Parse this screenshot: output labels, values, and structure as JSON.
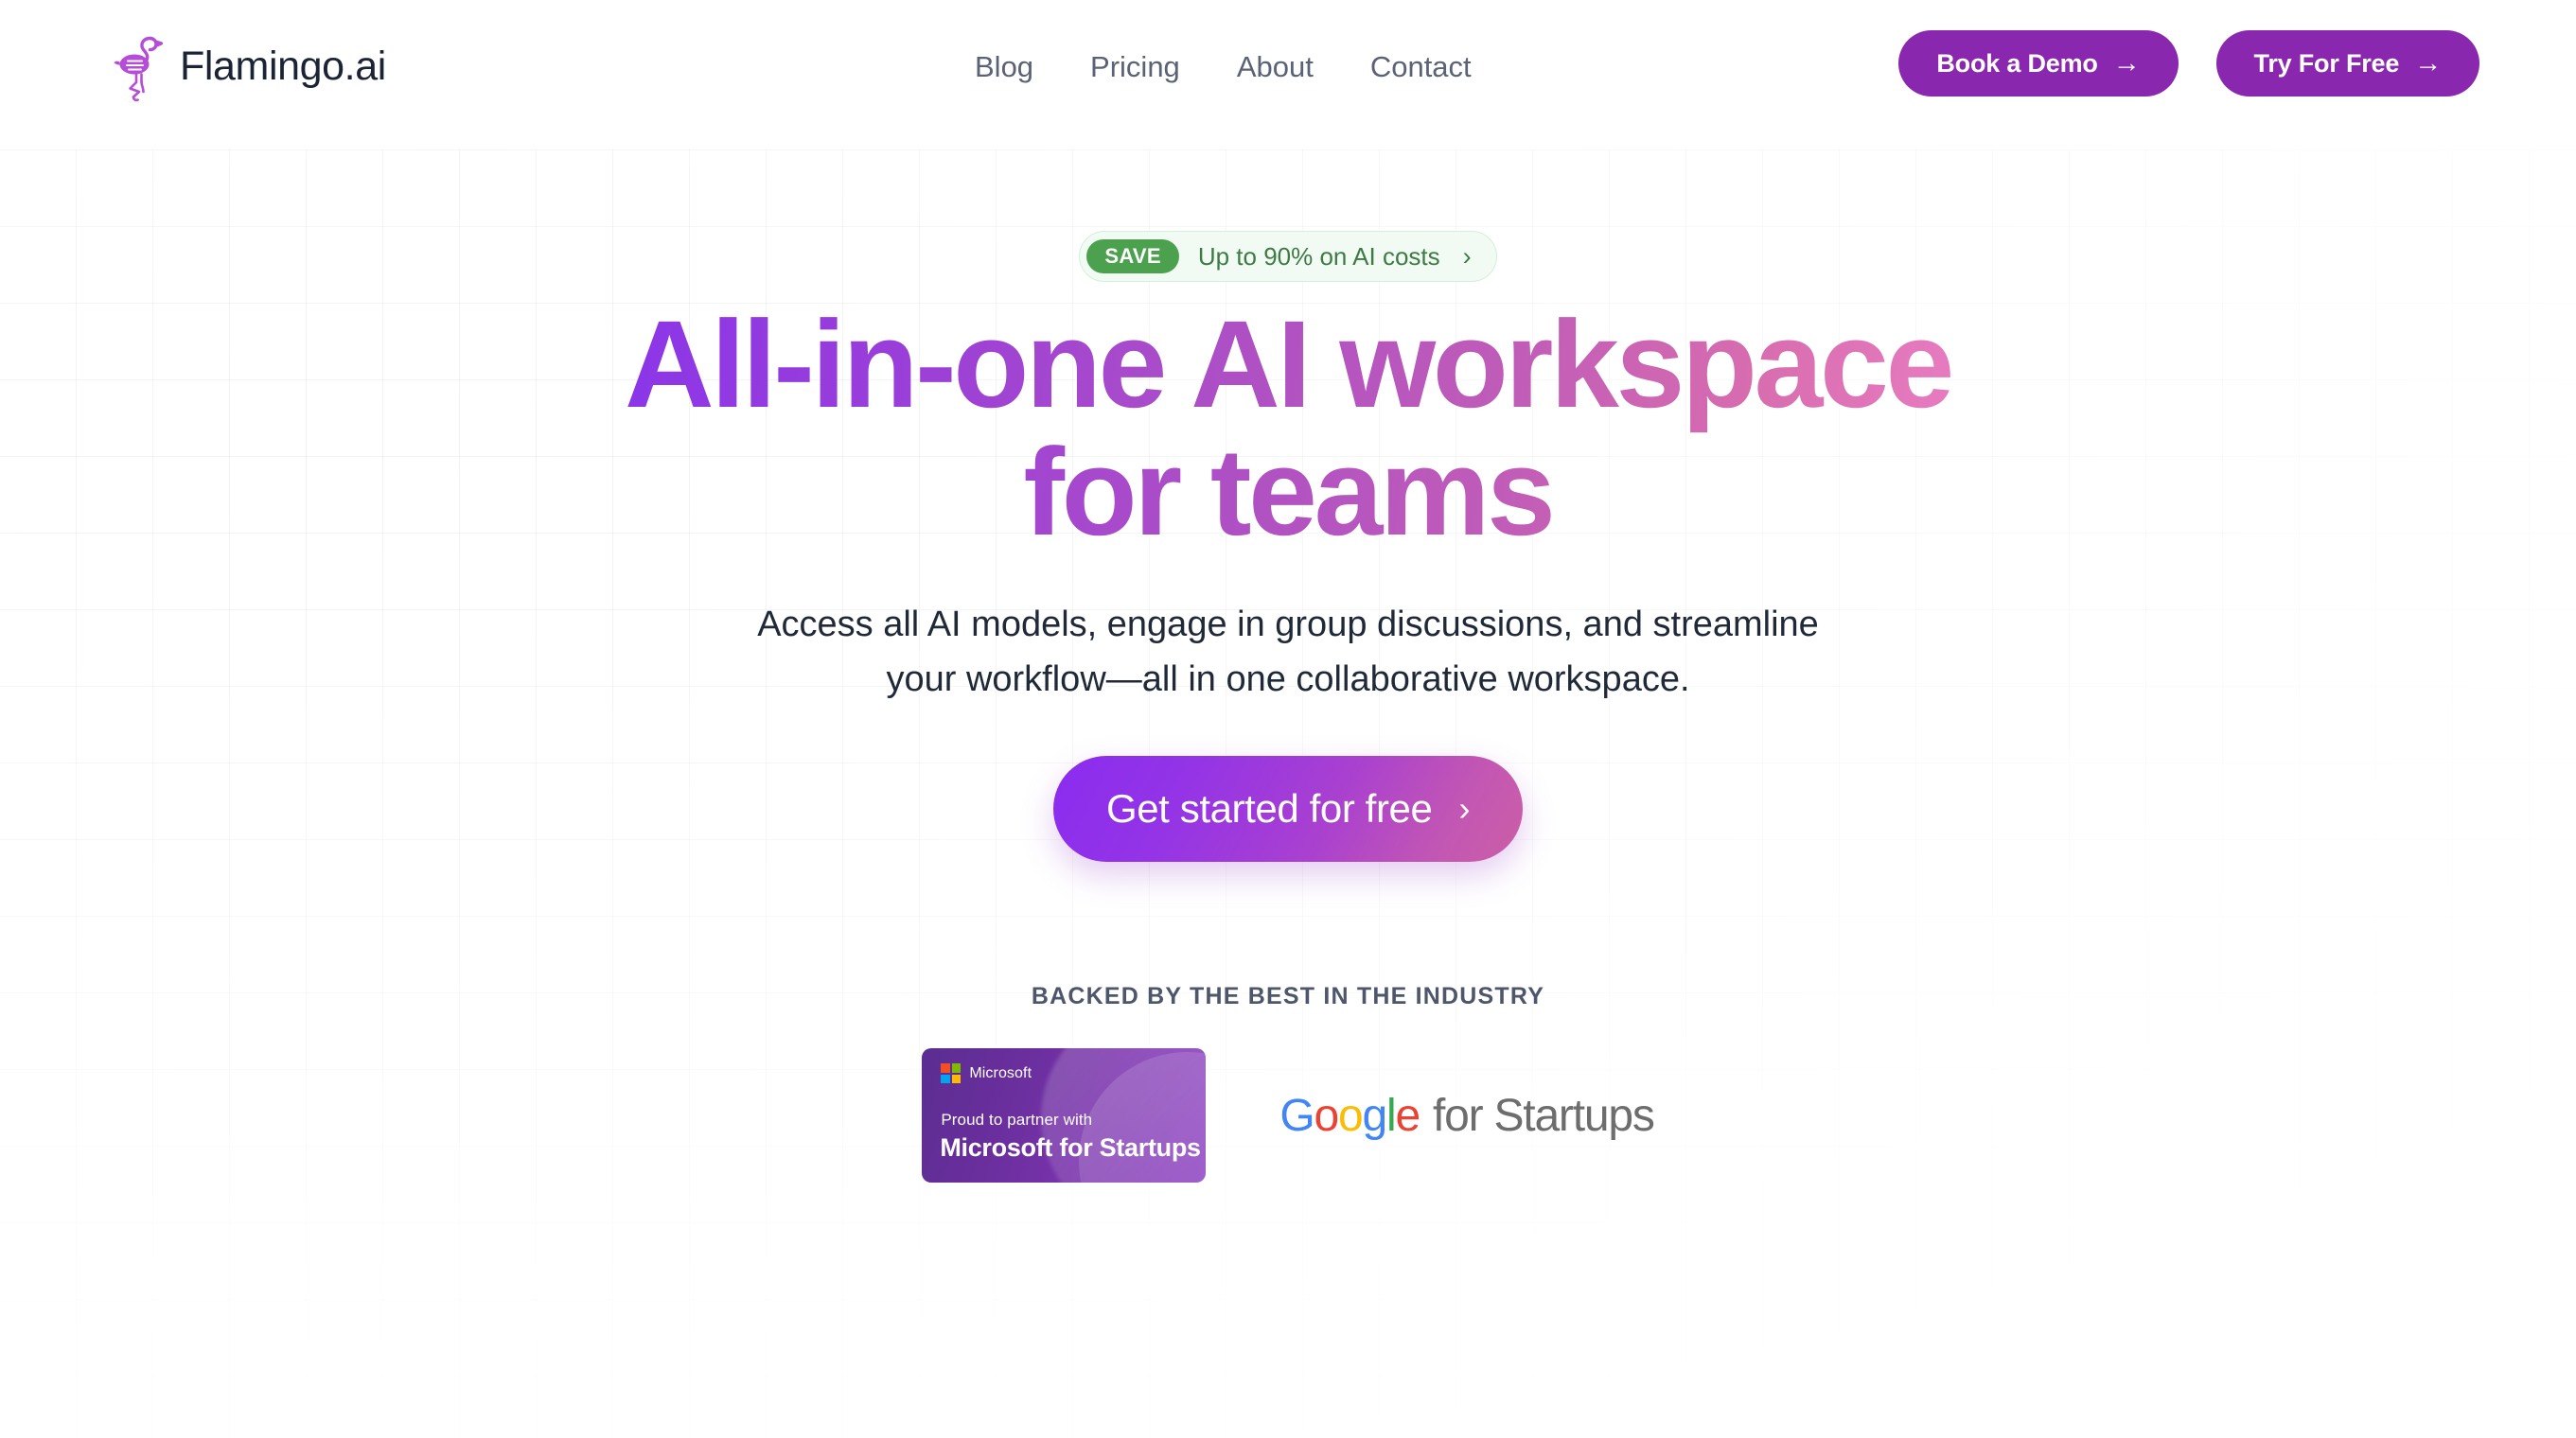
{
  "brand": {
    "name": "Flamingo.ai",
    "logo_icon": "flamingo-icon",
    "logo_color": "#B54DD8"
  },
  "nav": {
    "items": [
      {
        "label": "Blog"
      },
      {
        "label": "Pricing"
      },
      {
        "label": "About"
      },
      {
        "label": "Contact"
      }
    ]
  },
  "header_actions": {
    "book_demo": {
      "label": "Book a Demo",
      "icon": "arrow-right-icon",
      "glyph": "→",
      "bg": "#8A27AF"
    },
    "try_free": {
      "label": "Try For Free",
      "icon": "arrow-right-icon",
      "glyph": "→",
      "bg": "#8A27AF"
    }
  },
  "hero": {
    "badge": {
      "tag": "SAVE",
      "text": "Up to 90% on AI costs",
      "chevron_icon": "chevron-right-icon",
      "chevron_glyph": "›",
      "tag_bg": "#4CA14E",
      "bg": "#F2FBF3",
      "border": "#D4EFDA",
      "text_color": "#3E7B44"
    },
    "headline_line1": "All-in-one AI workspace",
    "headline_line2": "for teams",
    "headline_gradient_from": "#8B36E8",
    "headline_gradient_to": "#E87CC0",
    "subhead_line1": "Access all AI models, engage in group discussions, and streamline",
    "subhead_line2": "your workflow—all in one collaborative workspace.",
    "cta": {
      "label": "Get started for free",
      "chevron_icon": "chevron-right-icon",
      "chevron_glyph": "›",
      "gradient_from": "#8B2CF0",
      "gradient_to": "#CC5FA6"
    },
    "backed_label": "BACKED BY THE BEST IN THE INDUSTRY"
  },
  "partners": {
    "microsoft": {
      "brand": "Microsoft",
      "tagline": "Proud to partner with",
      "program": "Microsoft for Startups",
      "bg_from": "#5B2D91",
      "bg_to": "#9147C4",
      "square_colors": [
        "#F25022",
        "#7FBA00",
        "#00A4EF",
        "#FFB900"
      ]
    },
    "google": {
      "word": "Google",
      "rest": "for Startups",
      "letter_colors": [
        "#4285F4",
        "#EA4335",
        "#FBBC05",
        "#4285F4",
        "#34A853",
        "#EA4335"
      ],
      "rest_color": "#6D6D6D"
    }
  }
}
